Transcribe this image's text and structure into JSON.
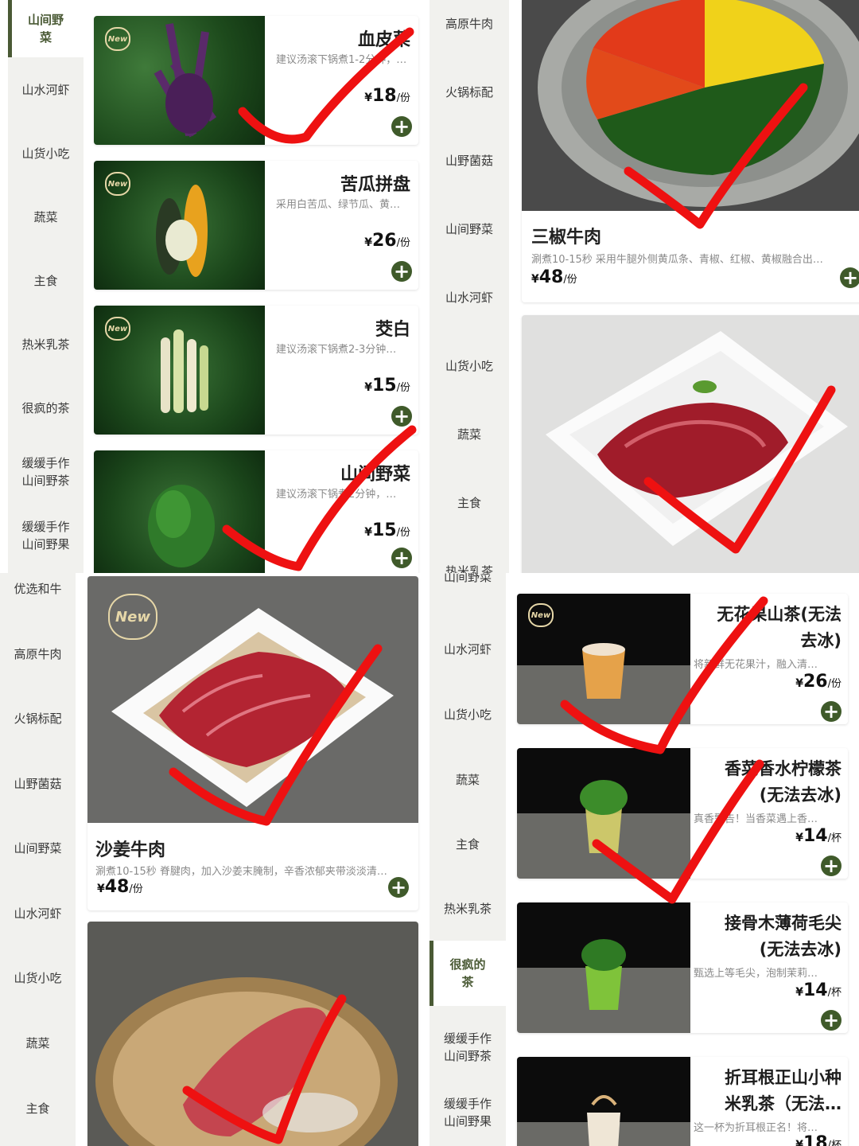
{
  "colors": {
    "accent": "#3f5a2a",
    "check_mark": "#ee1111",
    "sidebar_bg": "#f1f1ee"
  },
  "panel_tl": {
    "sidebar": [
      {
        "label": "山间野\n菜",
        "active": true
      },
      {
        "label": "山水河虾"
      },
      {
        "label": "山货小吃"
      },
      {
        "label": "蔬菜"
      },
      {
        "label": "主食"
      },
      {
        "label": "热米乳茶"
      },
      {
        "label": "很疯的茶"
      },
      {
        "label": "缓缓手作\n山间野茶"
      },
      {
        "label": "缓缓手作\n山间野果"
      }
    ],
    "items": [
      {
        "title": "血皮菜",
        "desc": "建议汤滚下锅煮1-2分钟，口感…",
        "currency": "¥",
        "price": "18",
        "unit": "/份",
        "badge": "New",
        "icon": "plus-circle-icon"
      },
      {
        "title": "苦瓜拼盘",
        "desc": "采用白苦瓜、绿节瓜、黄…",
        "currency": "¥",
        "price": "26",
        "unit": "/份",
        "badge": "New",
        "icon": "plus-circle-icon"
      },
      {
        "title": "茭白",
        "desc": "建议汤滚下锅煮2-3分钟…",
        "currency": "¥",
        "price": "15",
        "unit": "/份",
        "badge": "New",
        "icon": "plus-circle-icon"
      },
      {
        "title": "山间野菜",
        "desc": "建议汤滚下锅煮2分钟，…",
        "currency": "¥",
        "price": "15",
        "unit": "/份",
        "icon": "plus-circle-icon"
      }
    ]
  },
  "panel_tr": {
    "sidebar": [
      {
        "label": "高原牛肉"
      },
      {
        "label": "火锅标配"
      },
      {
        "label": "山野菌菇"
      },
      {
        "label": "山间野菜"
      },
      {
        "label": "山水河虾"
      },
      {
        "label": "山货小吃"
      },
      {
        "label": "蔬菜"
      },
      {
        "label": "主食"
      },
      {
        "label": "热米乳茶"
      }
    ],
    "items": [
      {
        "title": "三椒牛肉",
        "desc": "涮煮10-15秒 采用牛腿外侧黄瓜条、青椒、红椒、黄椒融合出…",
        "currency": "¥",
        "price": "48",
        "unit": "/份",
        "icon": "plus-circle-icon"
      }
    ]
  },
  "panel_bl": {
    "sidebar": [
      {
        "label": "优选和牛"
      },
      {
        "label": "高原牛肉"
      },
      {
        "label": "火锅标配"
      },
      {
        "label": "山野菌菇"
      },
      {
        "label": "山间野菜"
      },
      {
        "label": "山水河虾"
      },
      {
        "label": "山货小吃"
      },
      {
        "label": "蔬菜"
      },
      {
        "label": "主食"
      }
    ],
    "items": [
      {
        "title": "沙姜牛肉",
        "desc": "涮煮10-15秒 脊腱肉，加入沙姜末腌制，辛香浓郁夹带淡淡清…",
        "currency": "¥",
        "price": "48",
        "unit": "/份",
        "badge": "New",
        "icon": "plus-circle-icon"
      }
    ]
  },
  "panel_br": {
    "sidebar": [
      {
        "label": "山间野菜"
      },
      {
        "label": "山水河虾"
      },
      {
        "label": "山货小吃"
      },
      {
        "label": "蔬菜"
      },
      {
        "label": "主食"
      },
      {
        "label": "热米乳茶"
      },
      {
        "label": "很疯的\n茶",
        "active": true
      },
      {
        "label": "缓缓手作\n山间野茶"
      },
      {
        "label": "缓缓手作\n山间野果"
      }
    ],
    "items": [
      {
        "title": "无花果山茶(无法\n去冰)",
        "desc": "将新鲜无花果汁，融入清…",
        "currency": "¥",
        "price": "26",
        "unit": "/份",
        "badge": "New",
        "icon": "plus-circle-icon"
      },
      {
        "title": "香菜香水柠檬茶\n(无法去冰)",
        "desc": "真香警告！当香菜遇上香…",
        "currency": "¥",
        "price": "14",
        "unit": "/杯",
        "icon": "plus-circle-icon"
      },
      {
        "title": "接骨木薄荷毛尖\n(无法去冰)",
        "desc": "甄选上等毛尖，泡制茉莉…",
        "currency": "¥",
        "price": "14",
        "unit": "/杯",
        "icon": "plus-circle-icon"
      },
      {
        "title": "折耳根正山小种\n米乳茶（无法…",
        "desc": "这一杯为折耳根正名！将…",
        "currency": "¥",
        "price": "18",
        "unit": "/杯",
        "icon": "plus-circle-icon"
      }
    ]
  }
}
